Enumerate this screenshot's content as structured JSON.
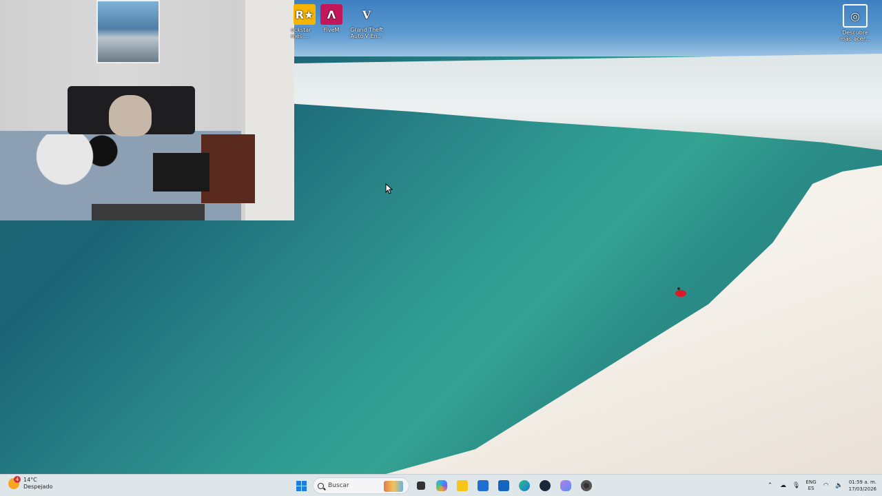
{
  "desktop": {
    "icons": [
      {
        "id": "rockstar",
        "label": "ockstar\nmes ...",
        "glyph": "R★",
        "icon": "rockstar-launcher-icon"
      },
      {
        "id": "fivem",
        "label": "FiveM",
        "glyph": "Λ",
        "icon": "fivem-icon"
      },
      {
        "id": "gtav",
        "label": "Grand Theft\nAuto V En...",
        "glyph": "V",
        "icon": "gta-v-icon"
      },
      {
        "id": "discover",
        "label": "Descubre\nmás acer...",
        "glyph": "◎",
        "icon": "discover-icon"
      }
    ]
  },
  "taskbar": {
    "weather": {
      "badge": "4",
      "temp": "14°C",
      "condition": "Despejado"
    },
    "search_placeholder": "Buscar",
    "apps": [
      {
        "name": "task-view-icon"
      },
      {
        "name": "copilot-icon"
      },
      {
        "name": "file-explorer-icon"
      },
      {
        "name": "store-icon"
      },
      {
        "name": "outlook-icon"
      },
      {
        "name": "edge-icon"
      },
      {
        "name": "steam-icon"
      },
      {
        "name": "game-controller-icon"
      },
      {
        "name": "recording-app-icon"
      }
    ],
    "tray": {
      "lang_top": "ENG",
      "lang_bottom": "ES",
      "time": "01:59 a. m.",
      "date": "17/03/2026"
    }
  },
  "colors": {
    "taskbar_bg": "#dfe6ea",
    "windows_blue": "#1f7de0",
    "fivem_pink": "#c2185b",
    "rockstar_yellow": "#f4b400",
    "gta_green": "#7cc242"
  }
}
